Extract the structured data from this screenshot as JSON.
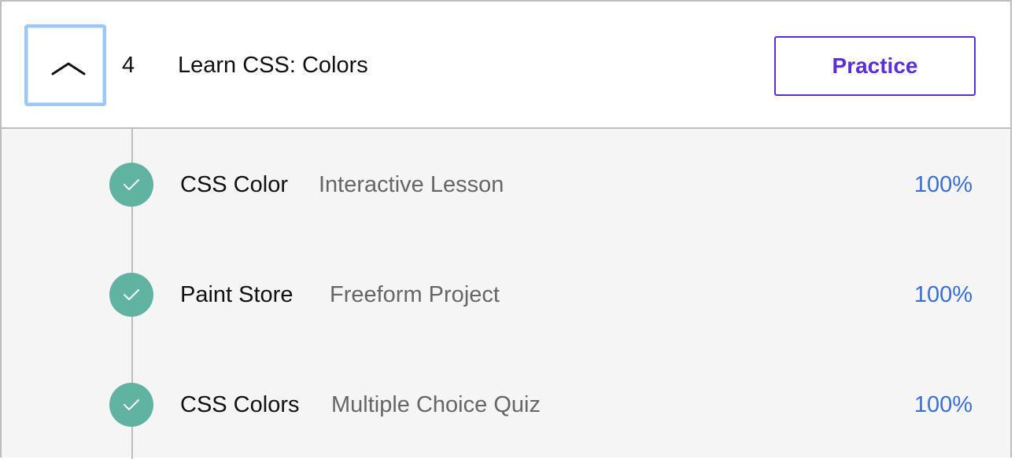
{
  "module": {
    "number": "4",
    "title": "Learn CSS: Colors",
    "toggle_icon": "chevron-up-icon",
    "practice_label": "Practice"
  },
  "lessons": [
    {
      "name": "CSS Color",
      "type": "Interactive Lesson",
      "progress": "100%",
      "status_icon": "check-icon"
    },
    {
      "name": "Paint Store",
      "type": "Freeform Project",
      "progress": "100%",
      "status_icon": "check-icon"
    },
    {
      "name": "CSS Colors",
      "type": "Multiple Choice Quiz",
      "progress": "100%",
      "status_icon": "check-icon"
    }
  ],
  "colors": {
    "accent": "#5b2fd6",
    "complete": "#5fb3a0",
    "progress_text": "#3a6fd8"
  }
}
